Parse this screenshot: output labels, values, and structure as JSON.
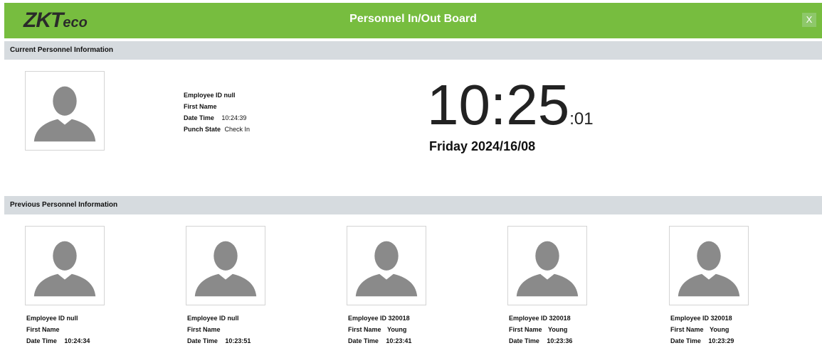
{
  "app": {
    "logo_main": "ZKT",
    "logo_eco": "eco",
    "title": "Personnel In/Out Board",
    "close_label": "X"
  },
  "current": {
    "section_label": "Current Personnel Information",
    "employee_id_label": "Employee ID",
    "employee_id": "null",
    "first_name_label": "First Name",
    "first_name": "",
    "date_time_label": "Date Time",
    "date_time": "10:24:39",
    "punch_state_label": "Punch State",
    "punch_state": "Check In"
  },
  "clock": {
    "time": "10:25",
    "seconds": ":01",
    "date": "Friday 2024/16/08"
  },
  "previous": {
    "section_label": "Previous Personnel Information",
    "employee_id_label": "Employee ID",
    "first_name_label": "First Name",
    "date_time_label": "Date Time",
    "records": [
      {
        "employee_id": "null",
        "first_name": "",
        "date_time": "10:24:34"
      },
      {
        "employee_id": "null",
        "first_name": "",
        "date_time": "10:23:51"
      },
      {
        "employee_id": "320018",
        "first_name": "Young",
        "date_time": "10:23:41"
      },
      {
        "employee_id": "320018",
        "first_name": "Young",
        "date_time": "10:23:36"
      },
      {
        "employee_id": "320018",
        "first_name": "Young",
        "date_time": "10:23:29"
      }
    ]
  },
  "colors": {
    "header_green": "#77bd3f",
    "section_gray": "#d6dbdf",
    "avatar_gray": "#8a8a8a"
  },
  "icons": {
    "avatar": "person-silhouette-icon",
    "close": "close-icon"
  }
}
